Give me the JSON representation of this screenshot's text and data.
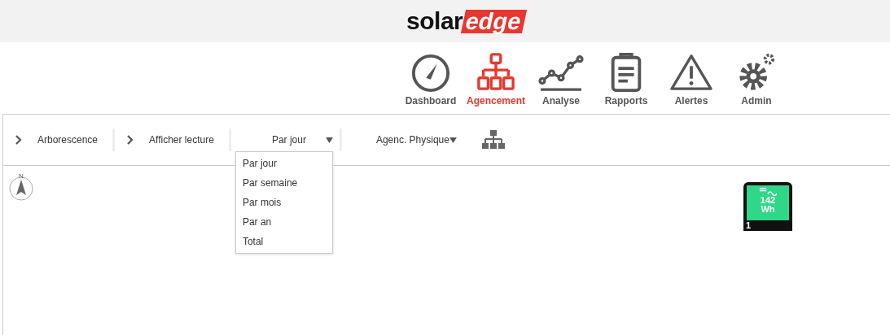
{
  "logo": {
    "text_1": "solar",
    "text_2": "edge"
  },
  "nav": [
    {
      "label": "Dashboard",
      "kind": "gauge",
      "selected": false
    },
    {
      "label": "Agencement",
      "kind": "hierarchy",
      "selected": true
    },
    {
      "label": "Analyse",
      "kind": "chart",
      "selected": false
    },
    {
      "label": "Rapports",
      "kind": "clipboard",
      "selected": false
    },
    {
      "label": "Alertes",
      "kind": "warning",
      "selected": false
    },
    {
      "label": "Admin",
      "kind": "gears",
      "selected": false
    }
  ],
  "toolbar": [
    {
      "kind": "expander",
      "label": "Arborescence"
    },
    {
      "kind": "expander",
      "label": "Afficher lecture"
    },
    {
      "kind": "select",
      "label": "Par jour",
      "open": true,
      "options": [
        "Par jour",
        "Par semaine",
        "Par mois",
        "Par an",
        "Total"
      ]
    },
    {
      "kind": "select",
      "label": "Agenc. Physique",
      "open": false
    },
    {
      "kind": "layout-button"
    }
  ],
  "compass": {
    "label": "N"
  },
  "inverter": {
    "value": "142",
    "unit": "Wh",
    "number": "1"
  }
}
